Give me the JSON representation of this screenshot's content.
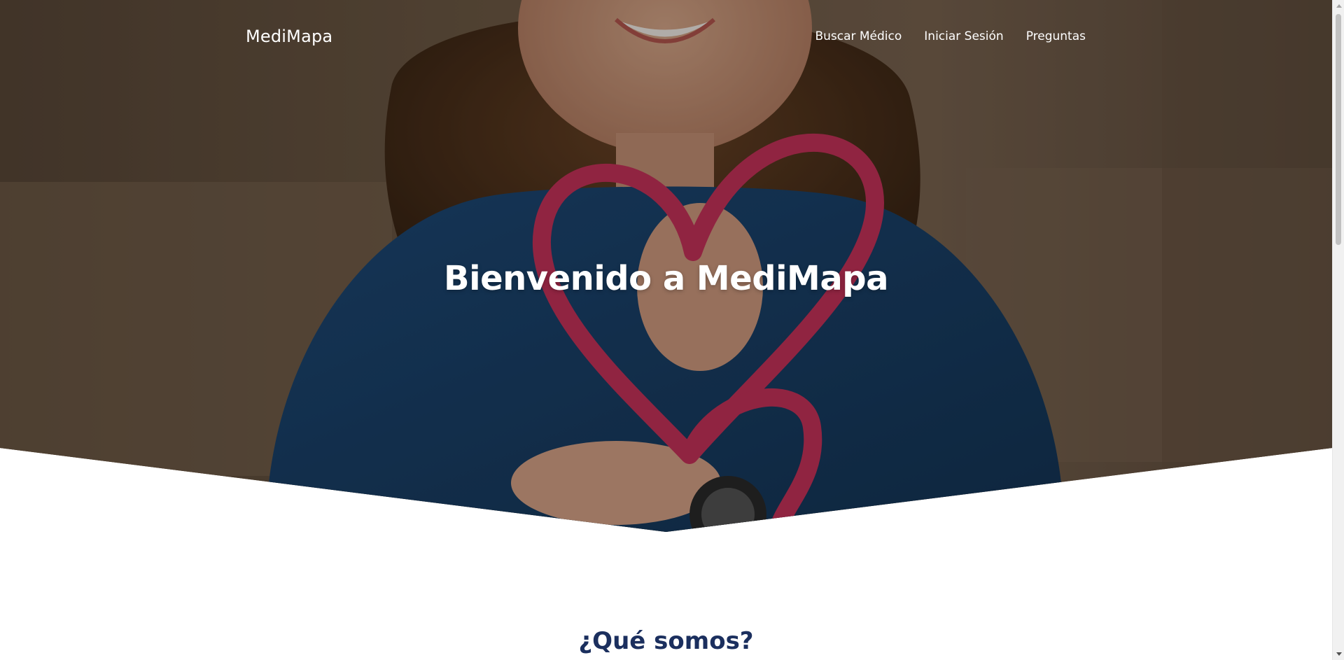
{
  "brand": {
    "name": "MediMapa"
  },
  "nav": {
    "items": [
      {
        "label": "Buscar Médico"
      },
      {
        "label": "Iniciar Sesión"
      },
      {
        "label": "Preguntas"
      }
    ]
  },
  "hero": {
    "title": "Bienvenido a MediMapa"
  },
  "about": {
    "title": "¿Qué somos?"
  },
  "colors": {
    "heading_blue": "#1b2f5e",
    "stethoscope_pink": "#c8325b",
    "shirt_blue": "#1d4670",
    "background_warm": "#6a543e"
  },
  "icons": {
    "scroll_up": "triangle-up-icon",
    "scroll_down": "triangle-down-icon"
  }
}
